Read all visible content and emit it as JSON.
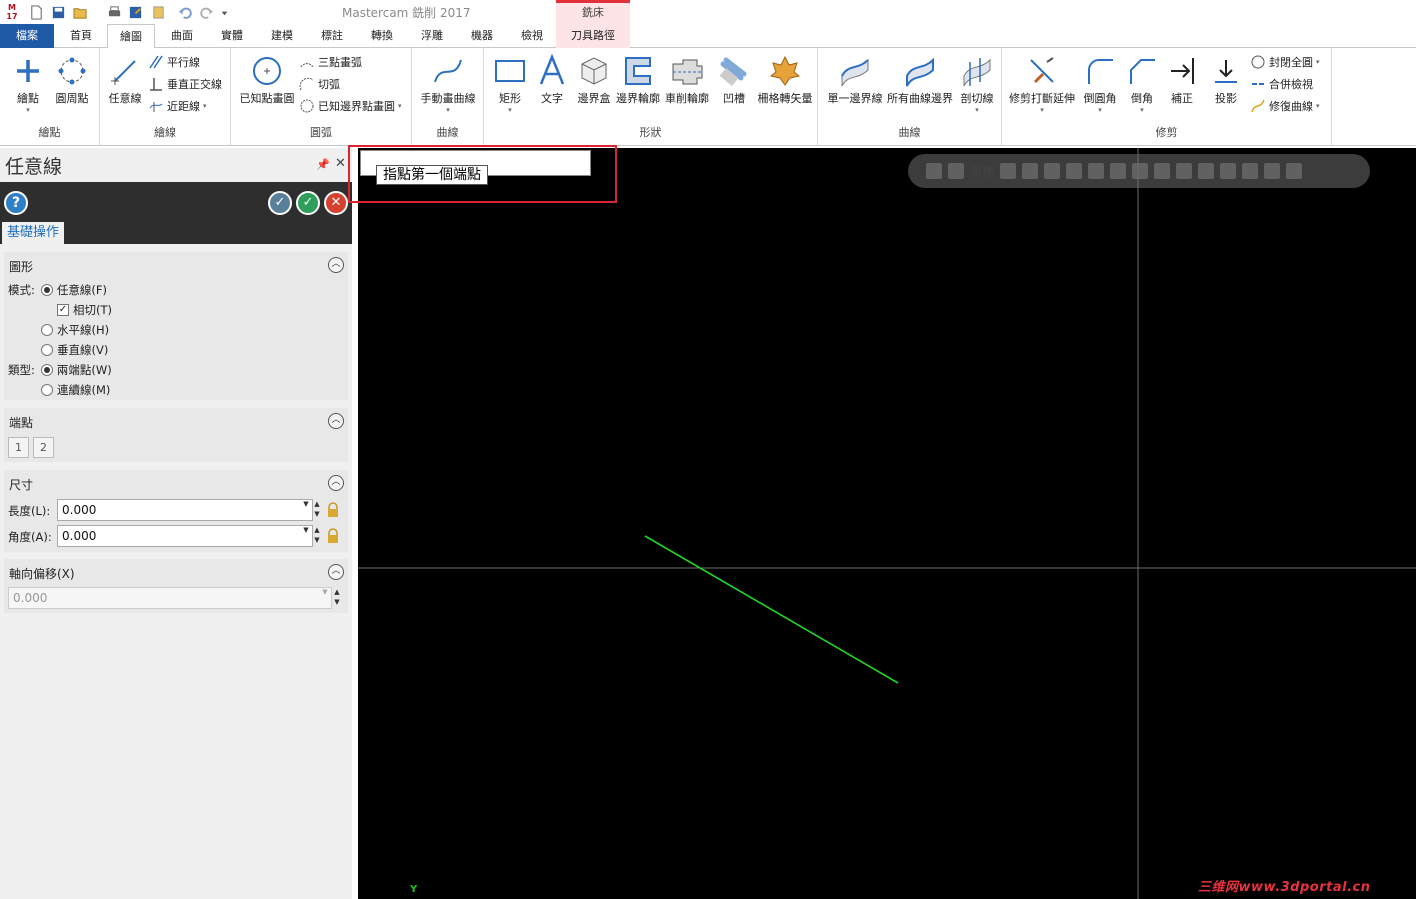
{
  "app": {
    "title": "Mastercam 銑削 2017",
    "logo_text": "17",
    "context_tab_group": "銑床"
  },
  "quick_access": [
    "new-icon",
    "save-icon",
    "open-icon",
    "print-icon",
    "save-as-icon",
    "properties-icon",
    "undo-icon",
    "redo-icon",
    "customize-icon"
  ],
  "tabs": [
    {
      "label": "檔案"
    },
    {
      "label": "首頁"
    },
    {
      "label": "繪圖"
    },
    {
      "label": "曲面"
    },
    {
      "label": "實體"
    },
    {
      "label": "建模"
    },
    {
      "label": "標註"
    },
    {
      "label": "轉換"
    },
    {
      "label": "浮雕"
    },
    {
      "label": "機器"
    },
    {
      "label": "檢視"
    },
    {
      "label": "刀具路徑"
    }
  ],
  "ribbon": {
    "groups": [
      {
        "label": "繪點"
      },
      {
        "label": "繪線"
      },
      {
        "label": "圓弧"
      },
      {
        "label": "曲線"
      },
      {
        "label": "形狀"
      },
      {
        "label": "曲線"
      },
      {
        "label": "修剪"
      }
    ],
    "buttons": {
      "draw_point": "繪點",
      "bolt_circle": "圓周點",
      "any_line": "任意線",
      "parallel": "平行線",
      "perpendicular": "垂直正交線",
      "closest_line": "近距線",
      "known_point_circle": "已知點畫圓",
      "three_point_arc": "三點畫弧",
      "tangent_arc": "切弧",
      "edge_point_circle": "已知邊界點畫圓",
      "manual_curve": "手動畫曲線",
      "rectangle": "矩形",
      "text": "文字",
      "bounding_box": "邊界盒",
      "boundary_profile": "邊界輪廓",
      "turn_profile": "車削輪廓",
      "slot": "凹槽",
      "grid_vector": "柵格轉矢量",
      "single_edge": "單一邊界線",
      "all_curve_edges": "所有曲線邊界",
      "cut_line": "剖切線",
      "trim_break_extend": "修剪打斷延伸",
      "fillet": "倒圓角",
      "chamfer": "倒角",
      "offset": "補正",
      "project": "投影",
      "close_all": "封閉全圓",
      "join_check": "合併檢視",
      "repair_curve": "修復曲線"
    }
  },
  "panel": {
    "title": "任意線",
    "tab": "基礎操作",
    "shape_section": {
      "title": "圖形",
      "mode_label": "模式:",
      "options": [
        "任意線(F)",
        "相切(T)",
        "水平線(H)",
        "垂直線(V)"
      ],
      "type_label": "類型:",
      "type_options": [
        "兩端點(W)",
        "連續線(M)"
      ],
      "selected_mode": "任意線(F)",
      "tangent_checked": true,
      "selected_type": "兩端點(W)"
    },
    "endpoint_section": {
      "title": "端點",
      "buttons": [
        "1",
        "2"
      ]
    },
    "dimension_section": {
      "title": "尺寸",
      "length_label": "長度(L):",
      "length_value": "0.000",
      "angle_label": "角度(A):",
      "angle_value": "0.000"
    },
    "axial_section": {
      "title": "軸向偏移(X)",
      "value": "0.000"
    }
  },
  "viewport": {
    "prompt": "指點第一個端點",
    "toolbar_cursor_label": "游標",
    "axis_label": "Y",
    "watermark": "三维网www.3dportal.cn",
    "colors": {
      "background": "#000000",
      "axis": "#6e6e6e",
      "geometry": "#22d422",
      "highlight": "#d9262e"
    }
  }
}
